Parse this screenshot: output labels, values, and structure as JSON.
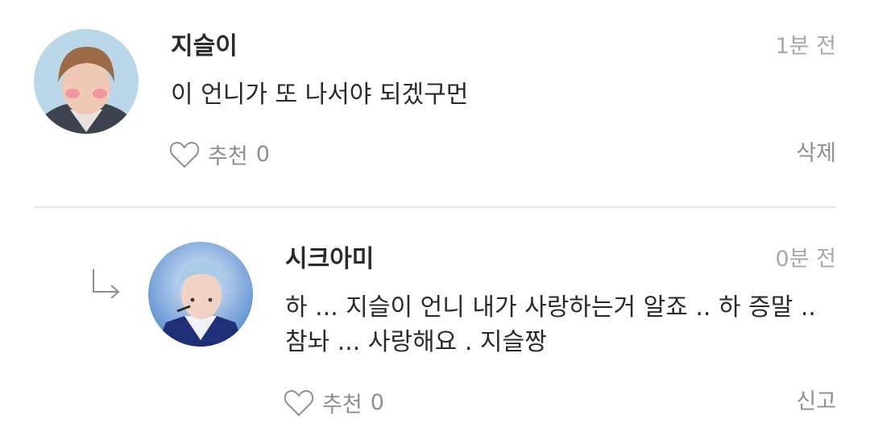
{
  "comments": [
    {
      "username": "지슬이",
      "time": "1분 전",
      "text": "이 언니가 또 나서야 되겠구먼",
      "like_label": "추천",
      "like_count": "0",
      "action_label": "삭제"
    },
    {
      "username": "시크아미",
      "time": "0분 전",
      "text": "하 ... 지슬이 언니 내가 사랑하는거 알죠 .. 하 증말 .. 참놔 ... 사랑해요 . 지슬짱",
      "like_label": "추천",
      "like_count": "0",
      "action_label": "신고"
    }
  ],
  "icons": {
    "like": "heart-outline-icon",
    "reply": "reply-arrow-icon"
  },
  "colors": {
    "text": "#2a2a2a",
    "muted": "#8f8f8f",
    "time": "#a8a8a8",
    "divider": "#e6e6e6"
  }
}
